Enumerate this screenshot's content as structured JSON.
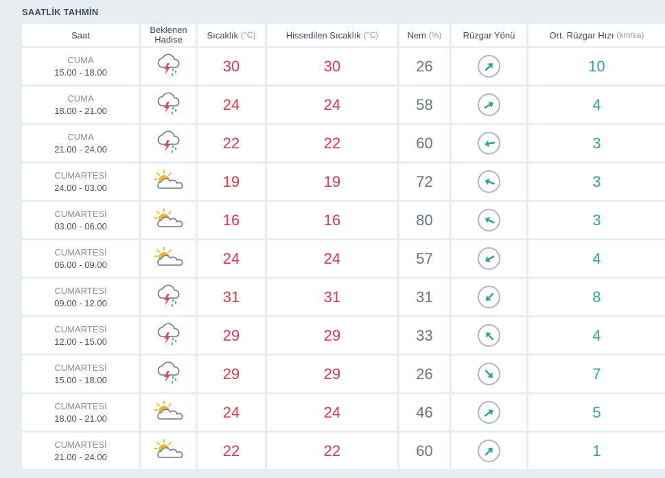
{
  "title": "SAATLİK TAHMİN",
  "headers": {
    "saat": "Saat",
    "hadise_line1": "Beklenen",
    "hadise_line2": "Hadise",
    "sicaklik": "Sıcaklık",
    "sicaklik_unit": "(°C)",
    "hissedilen": "Hissedilen Sıcaklık",
    "hissedilen_unit": "(°C)",
    "nem": "Nem",
    "nem_unit": "(%)",
    "ruzgar_yonu": "Rüzgar Yönü",
    "ruzgar_hizi": "Ort. Rüzgar Hızı",
    "ruzgar_hizi_unit": "(km/sa)"
  },
  "rows": [
    {
      "day": "CUMA",
      "time": "15.00 - 18.00",
      "icon": "thunderstorm-rain-icon",
      "temp": "30",
      "feels": "30",
      "humidity": "26",
      "wind_dir_deg": 45,
      "wind_speed": "10"
    },
    {
      "day": "CUMA",
      "time": "18.00 - 21.00",
      "icon": "thunderstorm-rain-icon",
      "temp": "24",
      "feels": "24",
      "humidity": "58",
      "wind_dir_deg": 60,
      "wind_speed": "4"
    },
    {
      "day": "CUMA",
      "time": "21.00 - 24.00",
      "icon": "thunderstorm-rain-icon",
      "temp": "22",
      "feels": "22",
      "humidity": "60",
      "wind_dir_deg": 260,
      "wind_speed": "3"
    },
    {
      "day": "CUMARTESİ",
      "time": "24.00 - 03.00",
      "icon": "partly-cloudy-icon",
      "temp": "19",
      "feels": "19",
      "humidity": "72",
      "wind_dir_deg": 290,
      "wind_speed": "3"
    },
    {
      "day": "CUMARTESİ",
      "time": "03.00 - 06.00",
      "icon": "partly-cloudy-icon",
      "temp": "16",
      "feels": "16",
      "humidity": "80",
      "wind_dir_deg": 295,
      "wind_speed": "3"
    },
    {
      "day": "CUMARTESİ",
      "time": "06.00 - 09.00",
      "icon": "partly-cloudy-icon",
      "temp": "24",
      "feels": "24",
      "humidity": "57",
      "wind_dir_deg": 240,
      "wind_speed": "4"
    },
    {
      "day": "CUMARTESİ",
      "time": "09.00 - 12.00",
      "icon": "thunderstorm-rain-icon",
      "temp": "31",
      "feels": "31",
      "humidity": "31",
      "wind_dir_deg": 225,
      "wind_speed": "8"
    },
    {
      "day": "CUMARTESİ",
      "time": "12.00 - 15.00",
      "icon": "thunderstorm-rain-icon",
      "temp": "29",
      "feels": "29",
      "humidity": "33",
      "wind_dir_deg": 315,
      "wind_speed": "4"
    },
    {
      "day": "CUMARTESİ",
      "time": "15.00 - 18.00",
      "icon": "thunderstorm-rain-icon",
      "temp": "29",
      "feels": "29",
      "humidity": "26",
      "wind_dir_deg": 135,
      "wind_speed": "7"
    },
    {
      "day": "CUMARTESİ",
      "time": "18.00 - 21.00",
      "icon": "partly-cloudy-icon",
      "temp": "24",
      "feels": "24",
      "humidity": "46",
      "wind_dir_deg": 55,
      "wind_speed": "5"
    },
    {
      "day": "CUMARTESİ",
      "time": "21.00 - 24.00",
      "icon": "partly-cloudy-icon",
      "temp": "22",
      "feels": "22",
      "humidity": "60",
      "wind_dir_deg": 45,
      "wind_speed": "1"
    }
  ],
  "colors": {
    "temperature": "#d9374c",
    "wind_arrow": "#2ea3a0",
    "lightning": "#e0455a",
    "rain_drop": "#2fae5a",
    "sun": "#f2b531",
    "background": "#e6ecf0"
  }
}
